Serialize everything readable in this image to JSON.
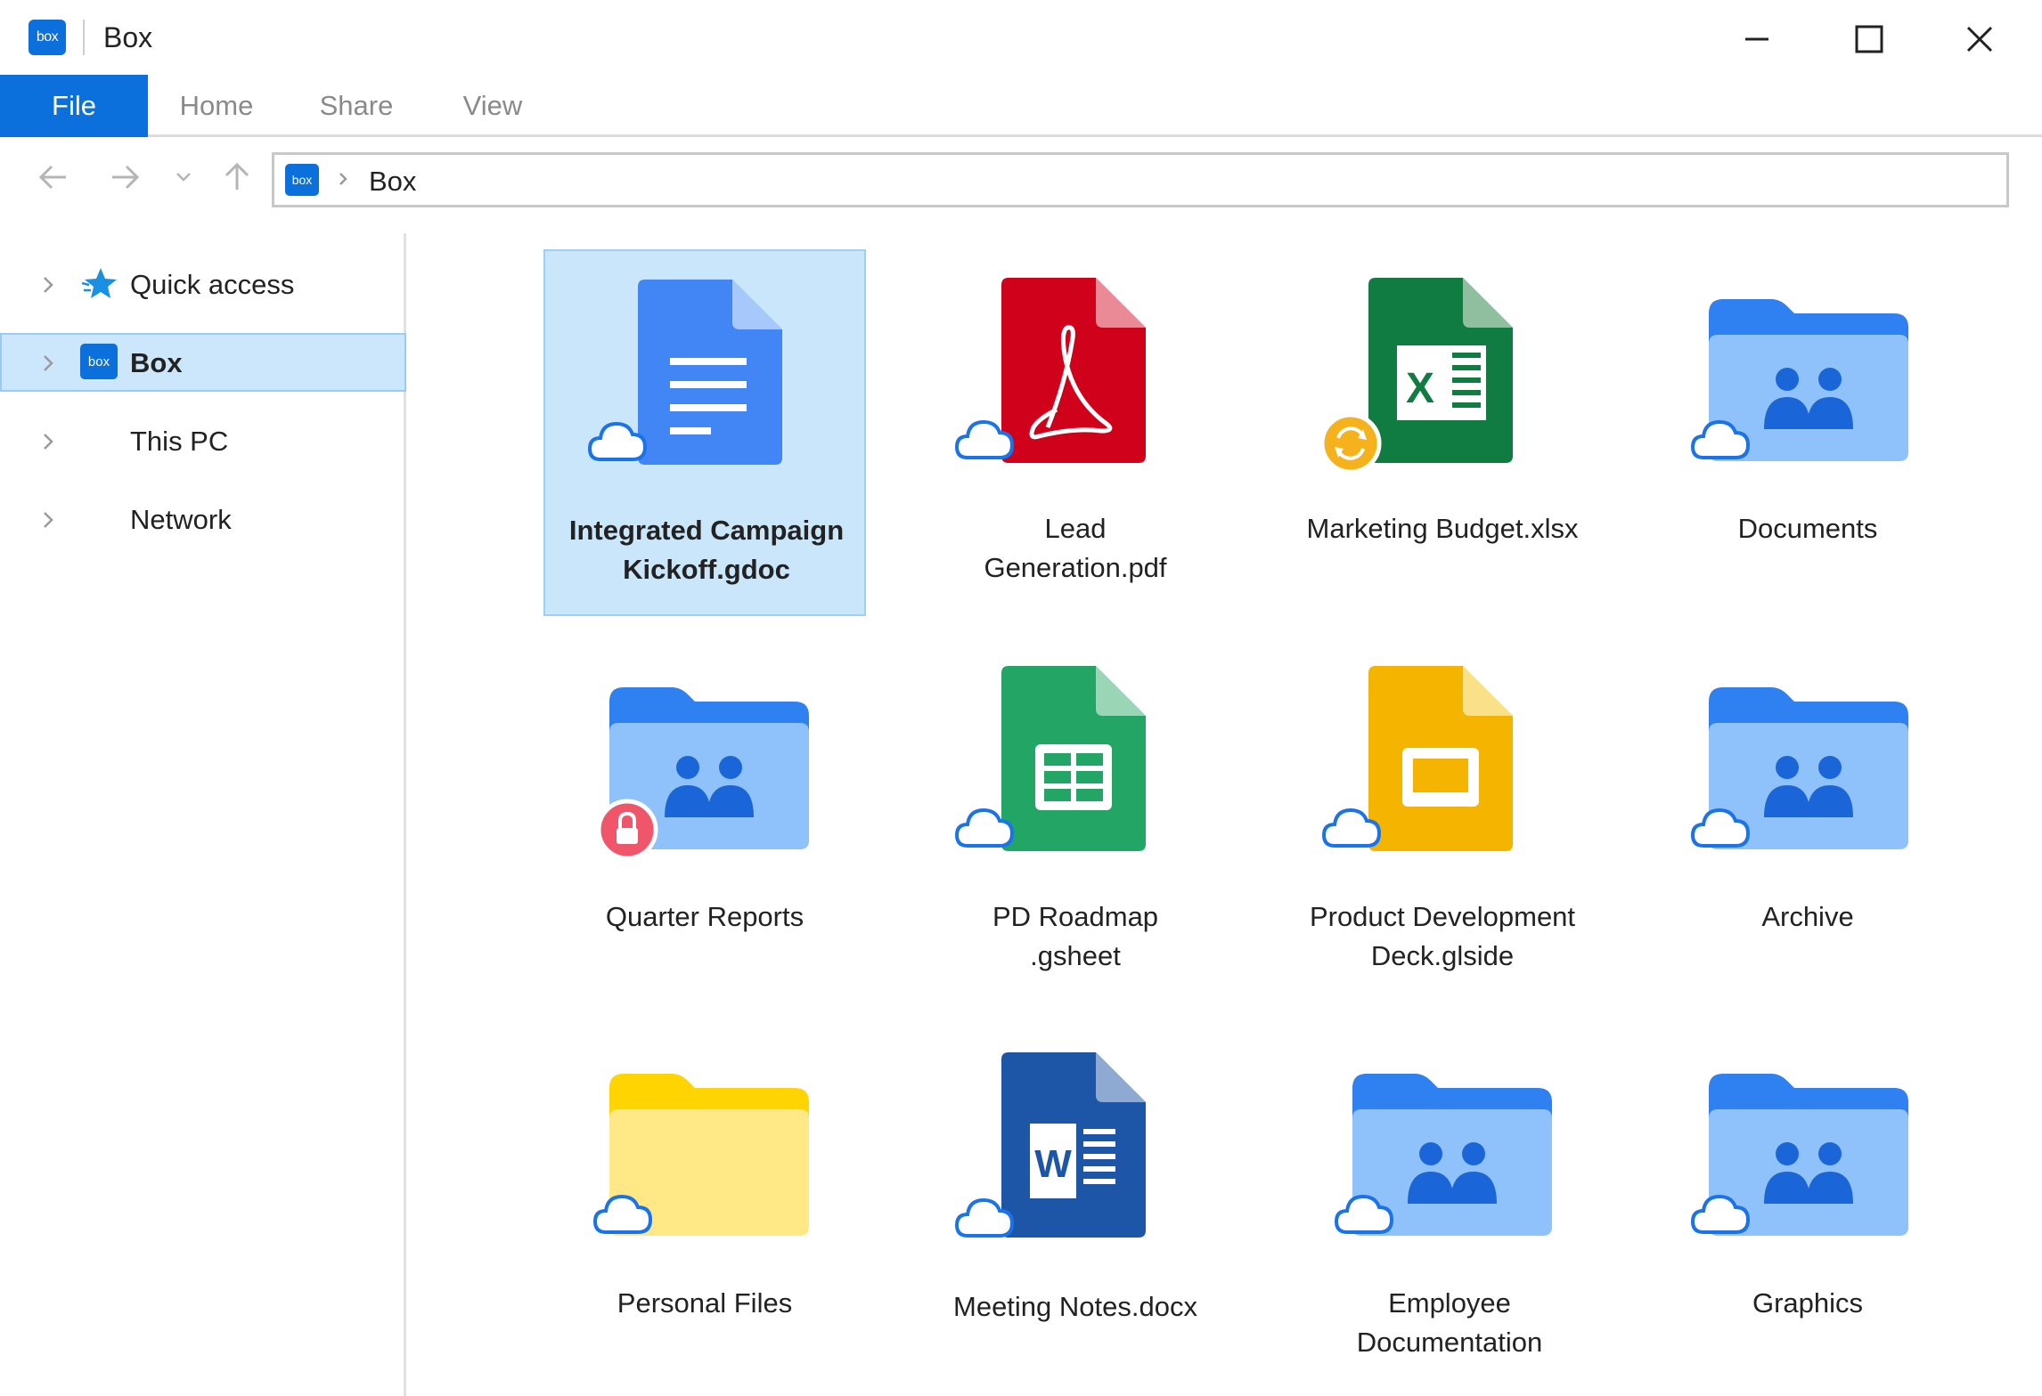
{
  "window": {
    "title": "Box",
    "logo_text": "box",
    "controls": [
      "minimize",
      "maximize",
      "close"
    ]
  },
  "ribbon": {
    "tabs": [
      {
        "label": "File",
        "active": true
      },
      {
        "label": "Home",
        "active": false
      },
      {
        "label": "Share",
        "active": false
      },
      {
        "label": "View",
        "active": false
      }
    ]
  },
  "address": {
    "logo_text": "box",
    "path": "Box"
  },
  "sidebar": {
    "items": [
      {
        "label": "Quick access",
        "icon": "star-icon",
        "selected": false
      },
      {
        "label": "Box",
        "icon": "box-logo-icon",
        "selected": true
      },
      {
        "label": "This PC",
        "icon": "",
        "selected": false
      },
      {
        "label": "Network",
        "icon": "",
        "selected": false
      }
    ]
  },
  "files": [
    {
      "name": "Integrated Campaign\nKickoff.gdoc",
      "type": "gdoc",
      "badge": "cloud",
      "selected": true
    },
    {
      "name": "Lead\nGeneration.pdf",
      "type": "pdf",
      "badge": "cloud",
      "selected": false
    },
    {
      "name": "Marketing Budget.xlsx",
      "type": "xlsx",
      "badge": "sync",
      "selected": false
    },
    {
      "name": "Documents",
      "type": "shared-folder",
      "badge": "cloud",
      "selected": false
    },
    {
      "name": "Quarter Reports",
      "type": "shared-folder",
      "badge": "lock",
      "selected": false
    },
    {
      "name": "PD Roadmap\n.gsheet",
      "type": "gsheet",
      "badge": "cloud",
      "selected": false
    },
    {
      "name": "Product Development\nDeck.glside",
      "type": "gslide",
      "badge": "cloud",
      "selected": false
    },
    {
      "name": "Archive",
      "type": "shared-folder",
      "badge": "cloud",
      "selected": false
    },
    {
      "name": "Personal Files",
      "type": "folder",
      "badge": "cloud",
      "selected": false
    },
    {
      "name": "Meeting Notes.docx",
      "type": "docx",
      "badge": "cloud",
      "selected": false
    },
    {
      "name": "Employee\nDocumentation",
      "type": "shared-folder",
      "badge": "cloud",
      "selected": false
    },
    {
      "name": "Graphics",
      "type": "shared-folder",
      "badge": "cloud",
      "selected": false
    }
  ],
  "colors": {
    "accent": "#0b6fdc",
    "selection": "#c9e6fa",
    "gdoc": "#4285f4",
    "pdf": "#d0021b",
    "xlsx": "#107c41",
    "gsheet": "#23a566",
    "gslide": "#f4b400",
    "docx": "#1d56a6",
    "shared_folder": "#8fc1fb",
    "folder": "#ffe680"
  }
}
